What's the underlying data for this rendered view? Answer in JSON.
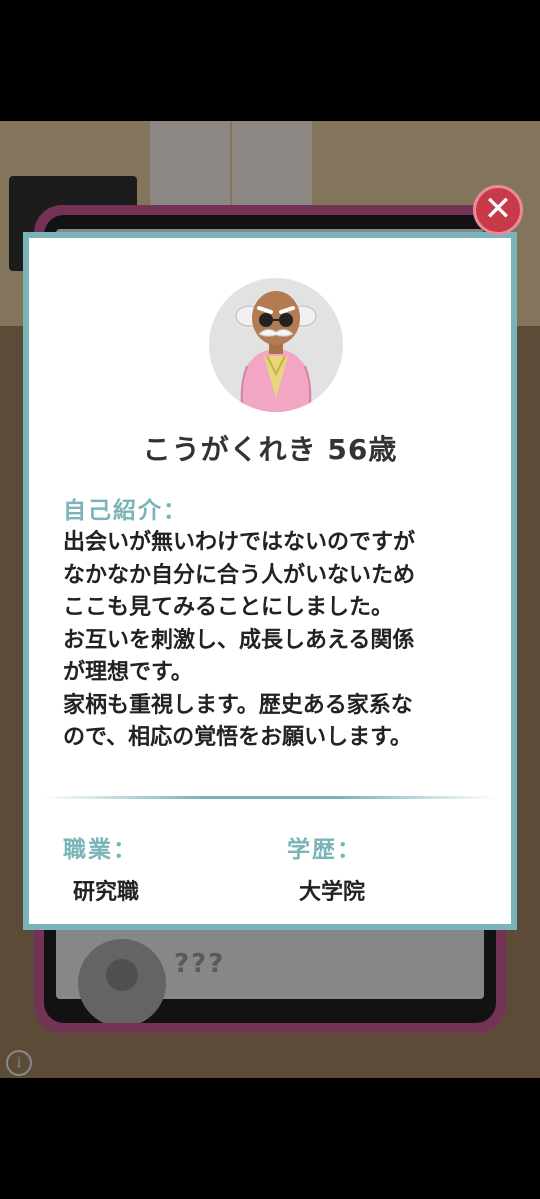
{
  "profile": {
    "name_age": "こうがくれき  56歳",
    "intro_label": "自己紹介：",
    "intro_text": "出会いが無いわけではないのですが\nなかなか自分に合う人がいないため\nここも見てみることにしました。\nお互いを刺激し、成長しあえる関係\nが理想です。\n家柄も重視します。歴史ある家系な\nので、相応の覚悟をお願いします。",
    "job_label": "職業：",
    "job_value": "研究職",
    "education_label": "学歴：",
    "education_value": "大学院"
  },
  "background": {
    "mystery_label": "???"
  },
  "colors": {
    "accent": "#7ab3b8",
    "close_button": "#c8394a",
    "tablet_frame": "#b34f84"
  },
  "icons": {
    "close": "close-icon",
    "info": "info-icon"
  }
}
